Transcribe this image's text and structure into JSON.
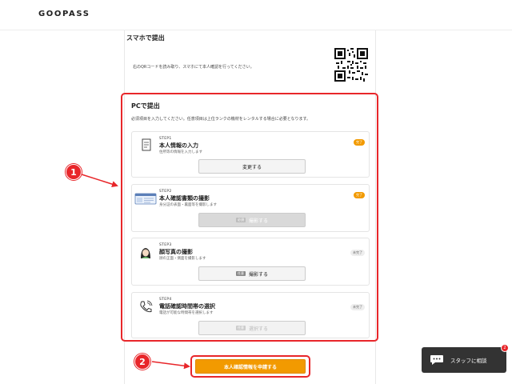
{
  "header": {
    "logo": "GOOPASS"
  },
  "smartphone": {
    "title": "スマホで提出",
    "description": "右のQRコードを読み取り、スマホにて本人確認を行ってください。"
  },
  "pc": {
    "title": "PCで提出",
    "description": "必須項目を入力してください。任意項目は上位ランクの機材をレンタルする場合に必要となります。",
    "steps": [
      {
        "label": "STEP1",
        "title": "本人情報の入力",
        "sub": "住所等の情報を入力します",
        "badge": "完了",
        "button": "変更する",
        "tag": ""
      },
      {
        "label": "STEP2",
        "title": "本人確認書類の撮影",
        "sub": "身分証の表面・裏面等を撮影します",
        "badge": "完了",
        "button": "撮影する",
        "tag": "必須"
      },
      {
        "label": "STEP3",
        "title": "顔写真の撮影",
        "sub": "顔の正面・側面を撮影します",
        "badge": "未完了",
        "button": "撮影する",
        "tag": "任意"
      },
      {
        "label": "STEP4",
        "title": "電話確認時間帯の選択",
        "sub": "電話が可能な時間帯を選択します",
        "badge": "未完了",
        "button": "選択する",
        "tag": "任意"
      }
    ]
  },
  "submit": {
    "label": "本人確認情報を申請する"
  },
  "callouts": {
    "one": "1",
    "two": "2"
  },
  "chat": {
    "label": "スタッフに相談",
    "count": "2"
  },
  "colors": {
    "accent": "#f29a00",
    "annotation": "#e8262a"
  }
}
